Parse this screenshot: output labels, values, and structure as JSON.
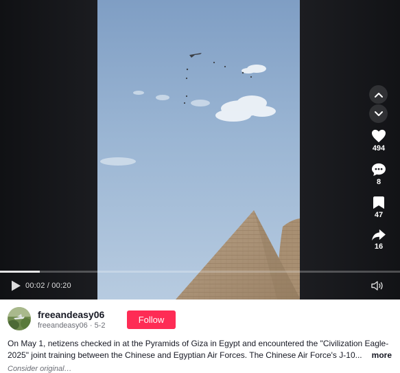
{
  "video": {
    "time_display": "00:02 / 00:20",
    "progress_fraction": 0.1
  },
  "actions": {
    "likes": "494",
    "comments": "8",
    "saves": "47",
    "shares": "16"
  },
  "author": {
    "username": "freeandeasy06",
    "handle": "freeandeasy06",
    "date": "5-2",
    "separator": " · "
  },
  "follow_label": "Follow",
  "caption": {
    "line1": "On May 1, netizens checked in at the Pyramids of Giza in Egypt and encountered the \"Civilization Eagle-",
    "line2": "2025\" joint training between the Chinese and Egyptian Air Forces. The Chinese Air Force's J-10...",
    "more_label": "more"
  },
  "source_note": "Consider original…",
  "colors": {
    "accent": "#fe2c55",
    "text": "#161823",
    "secondary": "#6b6d75"
  },
  "icons": {
    "play": "play-icon",
    "volume": "volume-icon",
    "up": "chevron-up-icon",
    "down": "chevron-down-icon",
    "like": "heart-icon",
    "comment": "comment-icon",
    "save": "bookmark-icon",
    "share": "share-icon"
  }
}
